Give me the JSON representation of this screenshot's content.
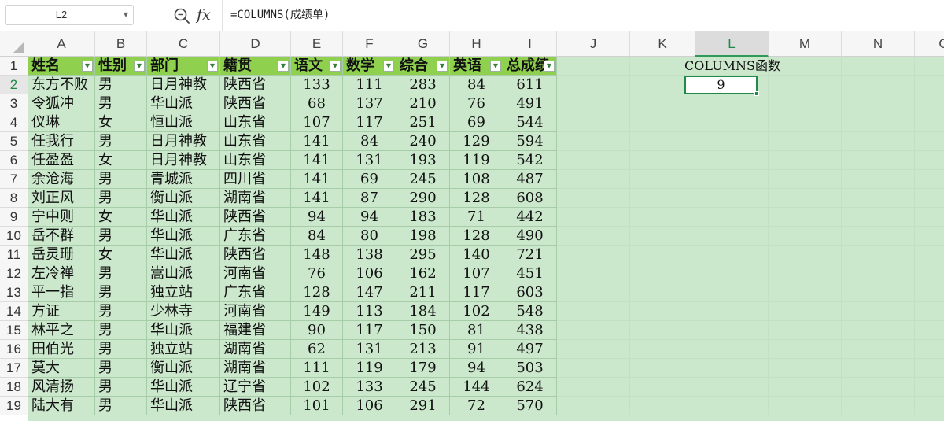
{
  "formula_bar": {
    "name_box": "L2",
    "fx_label": "fx",
    "formula": "=COLUMNS(成绩单)"
  },
  "columns": [
    "A",
    "B",
    "C",
    "D",
    "E",
    "F",
    "G",
    "H",
    "I",
    "J",
    "K",
    "L",
    "M",
    "N",
    "O"
  ],
  "selected_column": "L",
  "rows": [
    "1",
    "2",
    "3",
    "4",
    "5",
    "6",
    "7",
    "8",
    "9",
    "10",
    "11",
    "12",
    "13",
    "14",
    "15",
    "16",
    "17",
    "18",
    "19"
  ],
  "selected_row": "2",
  "table": {
    "headers": [
      "姓名",
      "性别",
      "部门",
      "籍贯",
      "语文",
      "数学",
      "综合",
      "英语",
      "总成绩"
    ],
    "rows": [
      [
        "东方不败",
        "男",
        "日月神教",
        "陕西省",
        "133",
        "111",
        "283",
        "84",
        "611"
      ],
      [
        "令狐冲",
        "男",
        "华山派",
        "陕西省",
        "68",
        "137",
        "210",
        "76",
        "491"
      ],
      [
        "仪琳",
        "女",
        "恒山派",
        "山东省",
        "107",
        "117",
        "251",
        "69",
        "544"
      ],
      [
        "任我行",
        "男",
        "日月神教",
        "山东省",
        "141",
        "84",
        "240",
        "129",
        "594"
      ],
      [
        "任盈盈",
        "女",
        "日月神教",
        "山东省",
        "141",
        "131",
        "193",
        "119",
        "542"
      ],
      [
        "余沧海",
        "男",
        "青城派",
        "四川省",
        "141",
        "69",
        "245",
        "108",
        "487"
      ],
      [
        "刘正风",
        "男",
        "衡山派",
        "湖南省",
        "141",
        "87",
        "290",
        "128",
        "608"
      ],
      [
        "宁中则",
        "女",
        "华山派",
        "陕西省",
        "94",
        "94",
        "183",
        "71",
        "442"
      ],
      [
        "岳不群",
        "男",
        "华山派",
        "广东省",
        "84",
        "80",
        "198",
        "128",
        "490"
      ],
      [
        "岳灵珊",
        "女",
        "华山派",
        "陕西省",
        "148",
        "138",
        "295",
        "140",
        "721"
      ],
      [
        "左冷禅",
        "男",
        "嵩山派",
        "河南省",
        "76",
        "106",
        "162",
        "107",
        "451"
      ],
      [
        "平一指",
        "男",
        "独立站",
        "广东省",
        "128",
        "147",
        "211",
        "117",
        "603"
      ],
      [
        "方证",
        "男",
        "少林寺",
        "河南省",
        "149",
        "113",
        "184",
        "102",
        "548"
      ],
      [
        "林平之",
        "男",
        "华山派",
        "福建省",
        "90",
        "117",
        "150",
        "81",
        "438"
      ],
      [
        "田伯光",
        "男",
        "独立站",
        "湖南省",
        "62",
        "131",
        "213",
        "91",
        "497"
      ],
      [
        "莫大",
        "男",
        "衡山派",
        "湖南省",
        "111",
        "119",
        "179",
        "94",
        "503"
      ],
      [
        "风清扬",
        "男",
        "华山派",
        "辽宁省",
        "102",
        "133",
        "245",
        "144",
        "624"
      ],
      [
        "陆大有",
        "男",
        "华山派",
        "陕西省",
        "101",
        "106",
        "291",
        "72",
        "570"
      ]
    ]
  },
  "side": {
    "label": "COLUMNS函数",
    "result": "9"
  },
  "colors": {
    "header_fill": "#8fd14f",
    "body_fill": "#cbe7cc",
    "active_border": "#1f8b47"
  },
  "icons": {
    "zoom": "zoom-formula-icon",
    "filter": "filter-dropdown-icon"
  }
}
